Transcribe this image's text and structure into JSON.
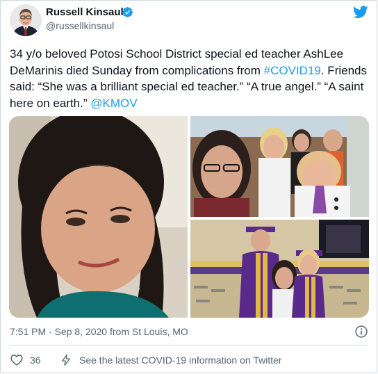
{
  "author": {
    "name": "Russell Kinsaul",
    "handle": "@russellkinsaul",
    "verified": true
  },
  "tweet": {
    "text_part1": "34 y/o beloved Potosi School District special ed teacher AshLee DeMarinis died Sunday from complications from ",
    "hashtag": "#COVID19",
    "text_part2": ". Friends said: “She was a brilliant special ed teacher.” “A true angel.” “A saint here on earth.” ",
    "mention": "@KMOV"
  },
  "meta": {
    "timestamp": "7:51 PM · Sep 8, 2020 from St Louis, MO"
  },
  "actions": {
    "like_count": "36",
    "covid_info": "See the latest COVID-19 information on Twitter"
  },
  "icons": [
    "twitter-bird-icon",
    "verified-badge-icon",
    "info-icon",
    "heart-icon",
    "lightning-bolt-icon"
  ],
  "colors": {
    "link": "#1d9bf0",
    "secondary_text": "#536471",
    "border": "#cfd9de"
  }
}
